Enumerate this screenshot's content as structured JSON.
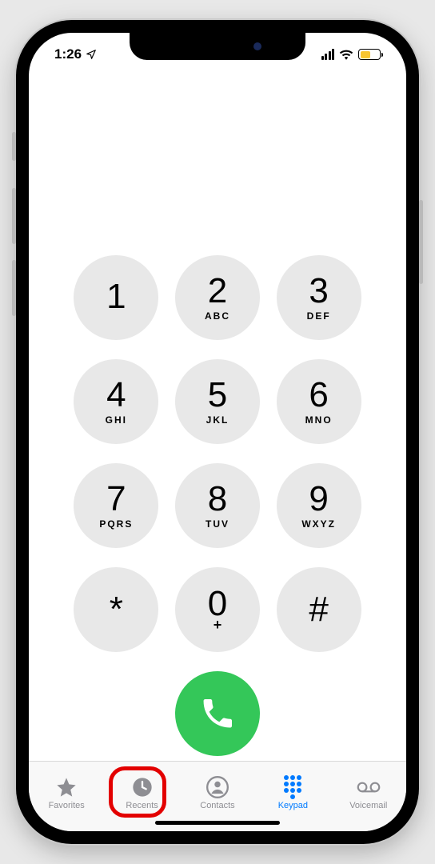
{
  "status": {
    "time": "1:26",
    "location_arrow": "➤"
  },
  "keypad": {
    "keys": [
      {
        "digit": "1",
        "letters": ""
      },
      {
        "digit": "2",
        "letters": "ABC"
      },
      {
        "digit": "3",
        "letters": "DEF"
      },
      {
        "digit": "4",
        "letters": "GHI"
      },
      {
        "digit": "5",
        "letters": "JKL"
      },
      {
        "digit": "6",
        "letters": "MNO"
      },
      {
        "digit": "7",
        "letters": "PQRS"
      },
      {
        "digit": "8",
        "letters": "TUV"
      },
      {
        "digit": "9",
        "letters": "WXYZ"
      },
      {
        "digit": "*",
        "letters": ""
      },
      {
        "digit": "0",
        "letters": "+"
      },
      {
        "digit": "#",
        "letters": ""
      }
    ]
  },
  "tabs": {
    "favorites": "Favorites",
    "recents": "Recents",
    "contacts": "Contacts",
    "keypad": "Keypad",
    "voicemail": "Voicemail"
  },
  "active_tab": "keypad",
  "highlighted_tab": "recents",
  "colors": {
    "accent": "#007aff",
    "call": "#34c759",
    "battery_low": "#f7c530",
    "highlight": "#e30000"
  }
}
